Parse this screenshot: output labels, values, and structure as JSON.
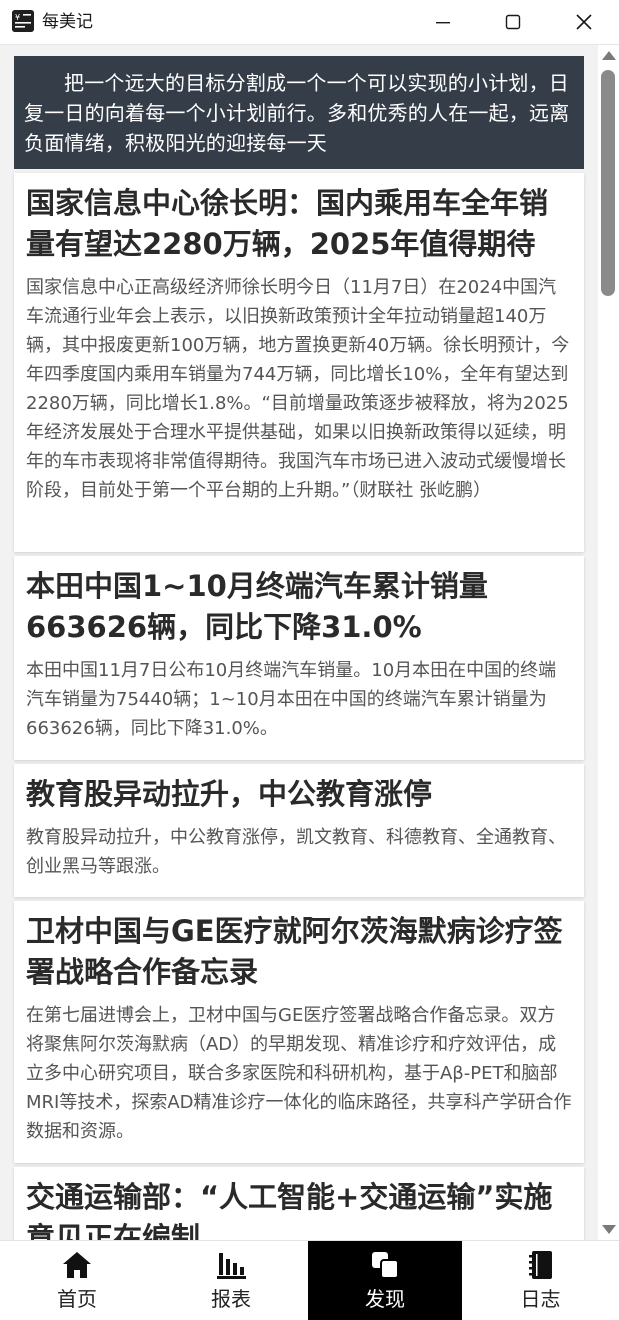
{
  "window": {
    "title": "每美记",
    "minimize_label": "minimize",
    "maximize_label": "maximize",
    "close_label": "close"
  },
  "banner": {
    "text": "把一个远大的目标分割成一个一个可以实现的小计划，日复一日的向着每一个小计划前行。多和优秀的人在一起，远离负面情绪，积极阳光的迎接每一天"
  },
  "news": [
    {
      "title": "国家信息中心徐长明：国内乘用车全年销量有望达2280万辆，2025年值得期待",
      "body": "国家信息中心正高级经济师徐长明今日（11月7日）在2024中国汽车流通行业年会上表示，以旧换新政策预计全年拉动销量超140万辆，其中报废更新100万辆，地方置换更新40万辆。徐长明预计，今年四季度国内乘用车销量为744万辆，同比增长10%，全年有望达到2280万辆，同比增长1.8%。“目前增量政策逐步被释放，将为2025年经济发展处于合理水平提供基础，如果以旧换新政策得以延续，明年的车市表现将非常值得期待。我国汽车市场已进入波动式缓慢增长阶段，目前处于第一个平台期的上升期。”（财联社 张屹鹏）"
    },
    {
      "title": "本田中国1~10月终端汽车累计销量663626辆，同比下降31.0%",
      "body": "本田中国11月7日公布10月终端汽车销量。10月本田在中国的终端汽车销量为75440辆；1~10月本田在中国的终端汽车累计销量为663626辆，同比下降31.0%。"
    },
    {
      "title": "教育股异动拉升，中公教育涨停",
      "body": "教育股异动拉升，中公教育涨停，凯文教育、科德教育、全通教育、创业黑马等跟涨。"
    },
    {
      "title": "卫材中国与GE医疗就阿尔茨海默病诊疗签署战略合作备忘录",
      "body": "在第七届进博会上，卫材中国与GE医疗签署战略合作备忘录。双方将聚焦阿尔茨海默病（AD）的早期发现、精准诊疗和疗效评估，成立多中心研究项目，联合多家医院和科研机构，基于Aβ-PET和脑部MRI等技术，探索AD精准诊疗一体化的临床路径，共享科产学研合作数据和资源。"
    },
    {
      "title": "交通运输部：“人工智能+交通运输”实施意见正在编制",
      "body": ""
    }
  ],
  "nav": {
    "home_label": "首页",
    "report_label": "报表",
    "discover_label": "发现",
    "log_label": "日志",
    "active": "discover"
  },
  "colors": {
    "banner_bg": "#343d48",
    "active_nav_bg": "#000000"
  },
  "icons": {
    "home": "home-icon",
    "report": "bar-chart-icon",
    "discover": "discover-icon",
    "log": "notebook-icon"
  }
}
